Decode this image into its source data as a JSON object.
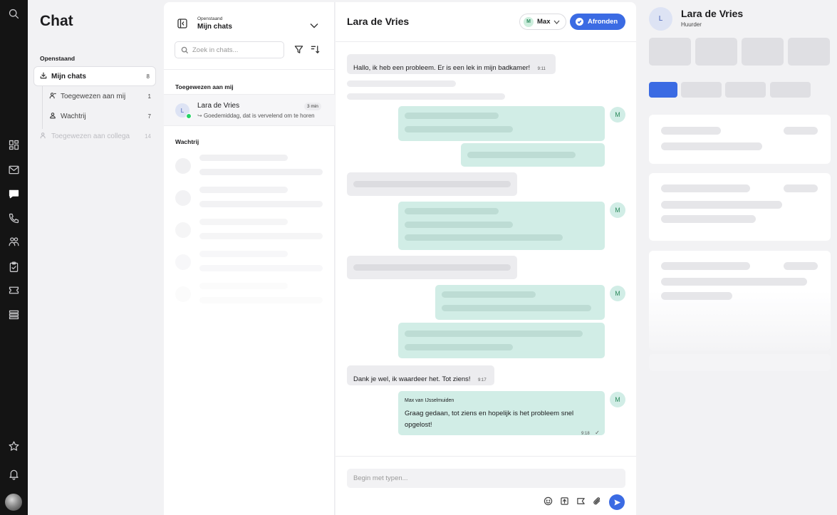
{
  "rail": {
    "icons": [
      "search-icon",
      "dashboard-icon",
      "mail-icon",
      "chat-icon",
      "phone-icon",
      "contacts-icon",
      "tasks-icon",
      "ticket-icon",
      "archive-icon",
      "star-icon",
      "bell-icon",
      "avatar"
    ]
  },
  "nav": {
    "title": "Chat",
    "section": "Openstaand",
    "items": [
      {
        "label": "Mijn chats",
        "count": "8"
      },
      {
        "label": "Toegewezen aan mij",
        "count": "1"
      },
      {
        "label": "Wachtrij",
        "count": "7"
      },
      {
        "label": "Toegewezen aan collega",
        "count": "14"
      }
    ]
  },
  "list": {
    "subtitle": "Openstaand",
    "title": "Mijn chats",
    "search_placeholder": "Zoek in chats...",
    "group_assigned": "Toegewezen aan mij",
    "group_queue": "Wachtrij",
    "chat": {
      "avatar": "L",
      "name": "Lara de Vries",
      "time": "3 min",
      "preview": "Goedemiddag, dat is vervelend om te horen"
    }
  },
  "conversation": {
    "contact": "Lara de Vries",
    "assignee_initial": "M",
    "assignee": "Max",
    "finish_label": "Afronden",
    "msg1": {
      "text": "Hallo, ik heb een probleem. Er is een lek in mijn badkamer!",
      "time": "9:11"
    },
    "msg2": {
      "text": "Dank je wel, ik waardeer het. Tot ziens!",
      "time": "9:17"
    },
    "msg3": {
      "sender": "Max van IJsselmuiden",
      "text": "Graag gedaan, tot ziens en hopelijk is het probleem snel opgelost!",
      "time": "9:18",
      "check": "✓"
    },
    "agent_initial": "M",
    "composer_placeholder": "Begin met typen..."
  },
  "contact_panel": {
    "avatar": "L",
    "name": "Lara de Vries",
    "role": "Huurder"
  },
  "colors": {
    "accent": "#3b6be3",
    "outgoing": "#d1ede6",
    "incoming": "#ececef",
    "rail": "#141414"
  }
}
